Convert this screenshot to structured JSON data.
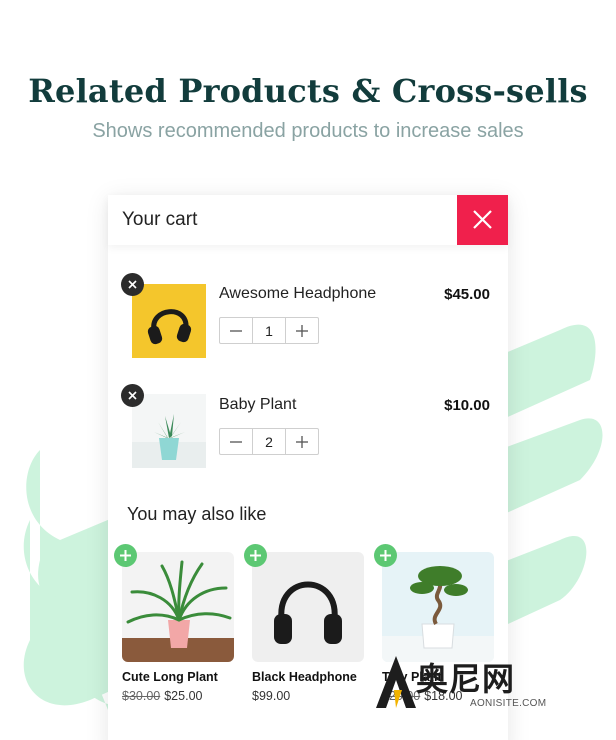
{
  "hero": {
    "title": "Related Products & Cross-sells",
    "subtitle": "Shows recommended products to increase sales"
  },
  "cart": {
    "title": "Your cart",
    "close_icon": "close-icon",
    "accent_color": "#f0204c",
    "items": [
      {
        "name": "Awesome Headphone",
        "price": "$45.00",
        "quantity": "1",
        "image": "yellow-headphone-image"
      },
      {
        "name": "Baby Plant",
        "price": "$10.00",
        "quantity": "2",
        "image": "succulent-pot-image"
      }
    ],
    "qty_decrement_icon": "minus-icon",
    "qty_increment_icon": "plus-icon",
    "remove_icon": "close-icon"
  },
  "recommendations": {
    "title": "You may also like",
    "add_icon": "plus-icon",
    "add_color": "#5cc873",
    "items": [
      {
        "name": "Cute Long Plant",
        "old_price": "$30.00",
        "price": "$25.00",
        "image": "fern-pink-pot-image"
      },
      {
        "name": "Black Headphone",
        "old_price": "",
        "price": "$99.00",
        "image": "black-headphone-image"
      },
      {
        "name": "Tiny Plant",
        "old_price": "$20.00",
        "price": "$18.00",
        "image": "bonsai-image"
      }
    ]
  },
  "watermark": {
    "text": "奥尼网",
    "url": "AONISITE.COM"
  }
}
